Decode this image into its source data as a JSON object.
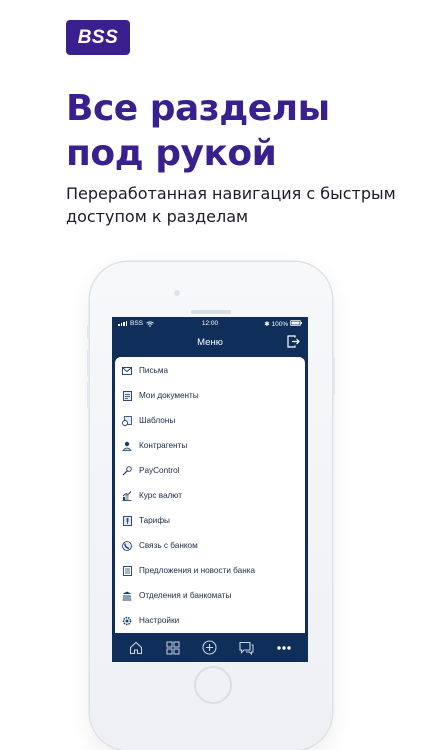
{
  "brand": {
    "logo_text": "BSS",
    "color": "#3a1f8f"
  },
  "hero": {
    "title": "Все разделы под рукой",
    "subtitle": "Переработанная навигация с быстрым доступом к разделам"
  },
  "statusbar": {
    "carrier": "BSS",
    "time": "12:00",
    "battery": "100%"
  },
  "navbar": {
    "title": "Меню",
    "logout_icon": "logout-icon"
  },
  "menu": {
    "items": [
      {
        "label": "Письма",
        "icon": "mail-icon"
      },
      {
        "label": "Мои документы",
        "icon": "document-icon"
      },
      {
        "label": "Шаблоны",
        "icon": "template-icon"
      },
      {
        "label": "Контрагенты",
        "icon": "contact-icon"
      },
      {
        "label": "PayControl",
        "icon": "paycontrol-icon"
      },
      {
        "label": "Курс валют",
        "icon": "currency-chart-icon"
      },
      {
        "label": "Тарифы",
        "icon": "tariff-icon"
      },
      {
        "label": "Связь с банком",
        "icon": "phone-call-icon"
      },
      {
        "label": "Предложения и новости банка",
        "icon": "news-icon"
      },
      {
        "label": "Отделения и банкоматы",
        "icon": "bank-icon"
      },
      {
        "label": "Настройки",
        "icon": "settings-icon"
      }
    ]
  },
  "tabbar": {
    "items": [
      {
        "icon": "home-icon"
      },
      {
        "icon": "grid-icon"
      },
      {
        "icon": "plus-circle-icon"
      },
      {
        "icon": "chat-icon"
      },
      {
        "icon": "more-icon"
      }
    ]
  },
  "colors": {
    "screen_bg": "#0f2e5a",
    "headline": "#3a1f8f"
  }
}
